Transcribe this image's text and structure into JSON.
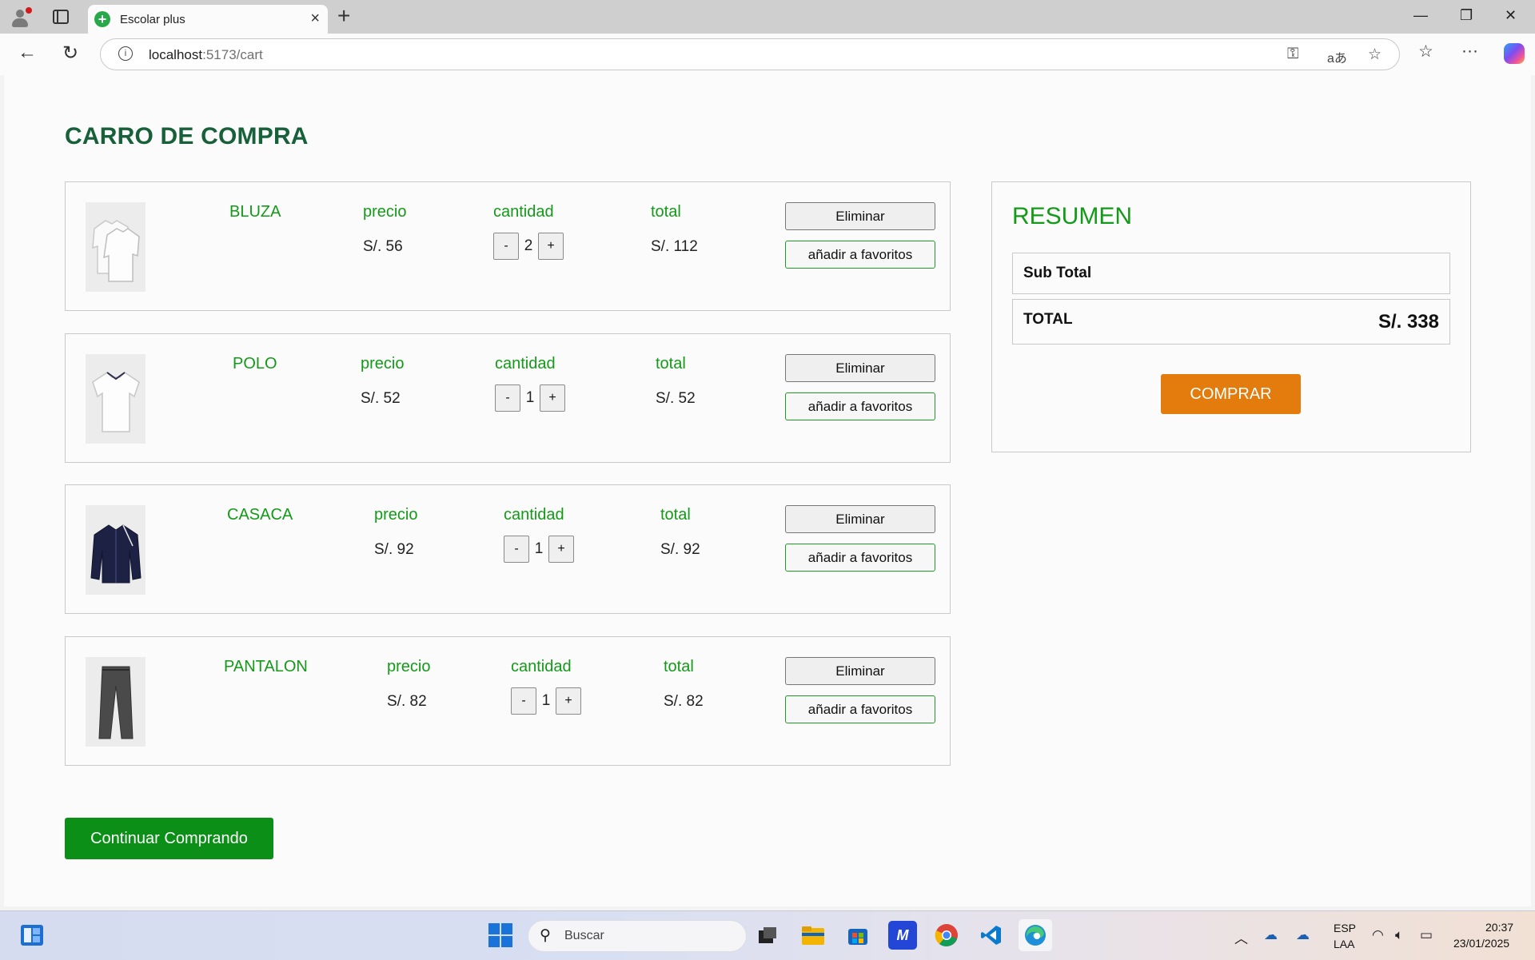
{
  "browser": {
    "tab_title": "Escolar plus",
    "url_host": "localhost",
    "url_rest": ":5173/cart",
    "new_tab_label": "+",
    "close_tab_label": "×"
  },
  "page": {
    "title": "CARRO DE COMPRA",
    "items": [
      {
        "name": "BLUZA",
        "price_label": "precio",
        "price": "S/. 56",
        "qty_label": "cantidad",
        "qty": "2",
        "total_label": "total",
        "total": "S/. 112",
        "image": "blouse-icon"
      },
      {
        "name": "POLO",
        "price_label": "precio",
        "price": "S/. 52",
        "qty_label": "cantidad",
        "qty": "1",
        "total_label": "total",
        "total": "S/. 52",
        "image": "polo-shirt-icon"
      },
      {
        "name": "CASACA",
        "price_label": "precio",
        "price": "S/. 92",
        "qty_label": "cantidad",
        "qty": "1",
        "total_label": "total",
        "total": "S/. 92",
        "image": "jacket-icon"
      },
      {
        "name": "PANTALON",
        "price_label": "precio",
        "price": "S/. 82",
        "qty_label": "cantidad",
        "qty": "1",
        "total_label": "total",
        "total": "S/. 82",
        "image": "trousers-icon"
      }
    ],
    "buttons": {
      "minus": "-",
      "plus": "+",
      "remove": "Eliminar",
      "favorite": "añadir a favoritos",
      "continue": "Continuar Comprando"
    },
    "summary": {
      "title": "RESUMEN",
      "subtotal_label": "Sub Total",
      "total_label": "TOTAL",
      "total_value": "S/. 338",
      "buy_label": "COMPRAR"
    }
  },
  "taskbar": {
    "search_placeholder": "Buscar",
    "lang_top": "ESP",
    "lang_bottom": "LAA",
    "time": "20:37",
    "date": "23/01/2025"
  },
  "colors": {
    "title_green": "#17603a",
    "label_green": "#139a18",
    "buy_orange": "#e37b0d",
    "continue_green": "#0b8f17"
  }
}
